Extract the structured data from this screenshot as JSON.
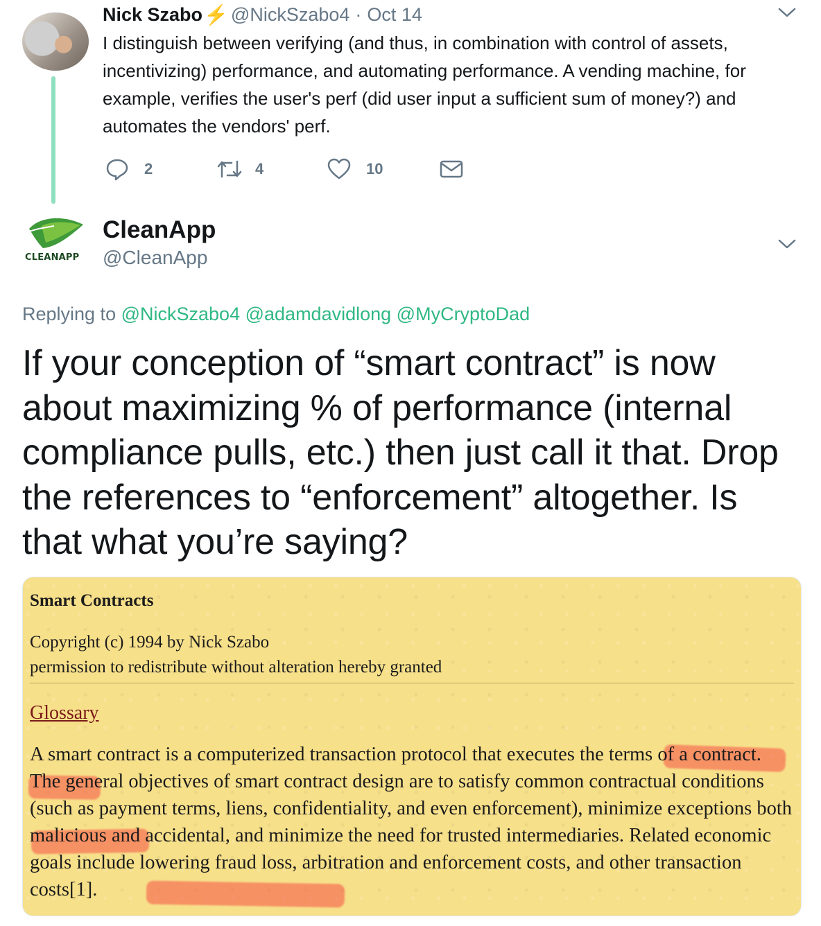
{
  "tweet1": {
    "name": "Nick Szabo",
    "badge_emoji": "⚡",
    "handle": "@NickSzabo4",
    "separator": "·",
    "date": "Oct 14",
    "text": "I distinguish between verifying (and thus, in combination with control of assets, incentivizing) performance, and automating performance. A vending machine, for example, verifies the user's perf (did user input a sufficient sum of money?) and automates the vendors' perf.",
    "replies": "2",
    "retweets": "4",
    "likes": "10"
  },
  "tweet2": {
    "name": "CleanApp",
    "handle": "@CleanApp",
    "logo_text": "CLEANAPP",
    "replying_label": "Replying to",
    "mentions": [
      "@NickSzabo4",
      "@adamdavidlong",
      "@MyCryptoDad"
    ],
    "text": "If your conception of “smart contract” is now about maximizing % of performance (internal compliance pulls, etc.) then just call it that. Drop the references to “enforcement” altogether. Is that what you’re saying?"
  },
  "document": {
    "title": "Smart Contracts",
    "copyright": "Copyright (c) 1994 by Nick Szabo",
    "permission": "permission to redistribute without alteration hereby granted",
    "glossary_link": "Glossary",
    "paragraph": "A smart contract is a computerized transaction protocol that executes the terms of a contract. The general objectives of smart contract design are to satisfy common contractual conditions (such as payment terms, liens, confidentiality, and even enforcement), minimize exceptions both malicious and accidental, and minimize the need for trusted intermediaries. Related economic goals include lowering fraud loss, arbitration and enforcement costs, and other transaction costs[1]."
  },
  "colors": {
    "thread_line": "#8fe0c0",
    "mention": "#2fb883",
    "muted": "#657786",
    "document_bg": "#f7e08a",
    "highlight": "#f55046"
  },
  "icons": [
    "reply-icon",
    "retweet-icon",
    "like-icon",
    "direct-message-icon",
    "chevron-down-icon",
    "lightning-icon",
    "leaf-logo-icon"
  ]
}
